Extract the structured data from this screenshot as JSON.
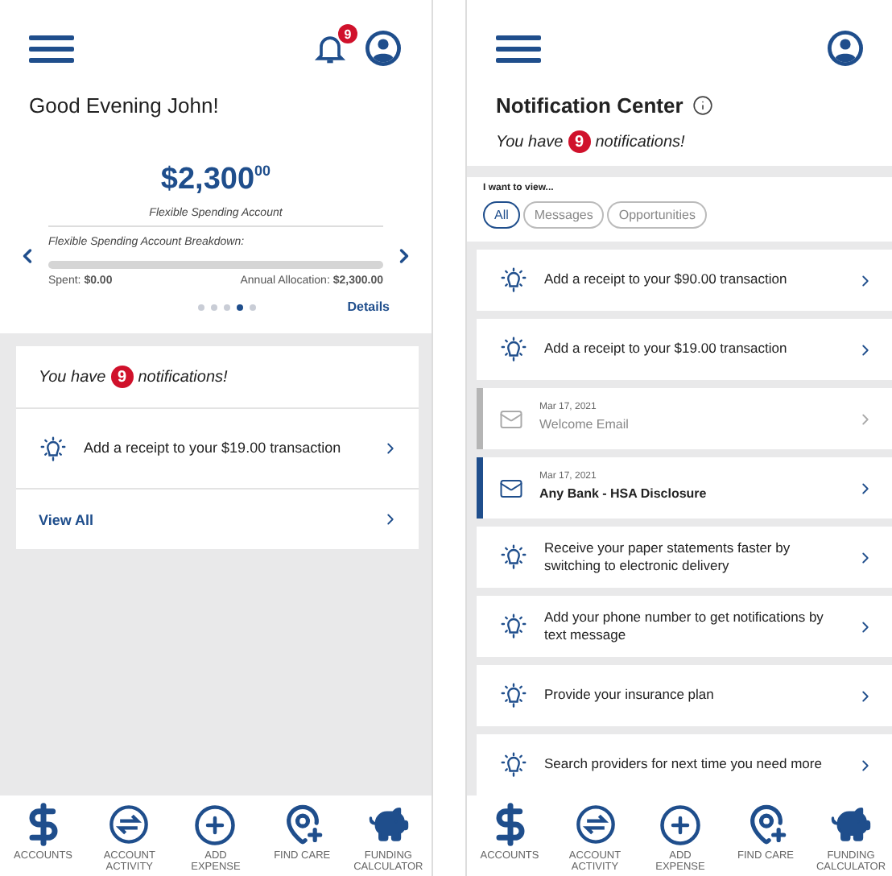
{
  "home_screen": {
    "header": {
      "notification_count": "9"
    },
    "greeting": "Good Evening John!",
    "balance": {
      "amount": "$2,300",
      "cents": "00",
      "label": "Flexible Spending Account"
    },
    "breakdown": {
      "title": "Flexible Spending Account Breakdown:",
      "level": 0,
      "spent_label": "Spent:",
      "spent": "$0.00",
      "allocation_label": "Annual Allocation:",
      "allocation": "$2,300.00"
    },
    "pager": [
      {
        "selected": false
      },
      {
        "selected": false
      },
      {
        "selected": false
      },
      {
        "selected": true
      },
      {
        "selected": false
      }
    ],
    "details_link": "Details",
    "notifications": {
      "prefix": "You have",
      "count": "9",
      "suffix": "notifications!",
      "items": [
        {
          "kind": "tip",
          "text": "Add a receipt to your $19.00 transaction"
        }
      ],
      "view_all": "View All"
    },
    "tab_bar": [
      {
        "kind": "dollar",
        "lines": [
          "ACCOUNTS"
        ]
      },
      {
        "kind": "swap",
        "lines": [
          "ACCOUNT",
          "ACTIVITY"
        ]
      },
      {
        "kind": "plus",
        "lines": [
          "ADD",
          "EXPENSE"
        ]
      },
      {
        "kind": "pin",
        "lines": [
          "FIND CARE"
        ]
      },
      {
        "kind": "piggy",
        "lines": [
          "FUNDING",
          "CALCULATOR"
        ]
      }
    ]
  },
  "notification_screen": {
    "title": "Notification Center",
    "summary": {
      "prefix": "You have",
      "count": "9",
      "suffix": "notifications!"
    },
    "filter_label": "I want to view...",
    "filters": [
      {
        "label": "All",
        "selected": true
      },
      {
        "label": "Messages",
        "selected": false
      },
      {
        "label": "Opportunities",
        "selected": false
      }
    ],
    "items": [
      {
        "kind": "tip",
        "text": "Add a receipt to your $90.00 transaction"
      },
      {
        "kind": "tip",
        "text": "Add a receipt to your $19.00 transaction"
      },
      {
        "kind": "message",
        "date": "Mar 17, 2021",
        "text": "Welcome Email",
        "read": true
      },
      {
        "kind": "message",
        "date": "Mar 17, 2021",
        "text": "Any Bank - HSA Disclosure",
        "read": false
      },
      {
        "kind": "tip",
        "text": "Receive your paper statements faster by switching to electronic delivery"
      },
      {
        "kind": "tip",
        "text": "Add your phone number to get notifications by text message"
      },
      {
        "kind": "tip",
        "text": "Provide your insurance plan"
      },
      {
        "kind": "tip",
        "text": "Search providers for next time you need more"
      }
    ],
    "tab_bar": [
      {
        "kind": "dollar",
        "lines": [
          "ACCOUNTS"
        ]
      },
      {
        "kind": "swap",
        "lines": [
          "ACCOUNT",
          "ACTIVITY"
        ]
      },
      {
        "kind": "plus",
        "lines": [
          "ADD",
          "EXPENSE"
        ]
      },
      {
        "kind": "pin",
        "lines": [
          "FIND CARE"
        ]
      },
      {
        "kind": "piggy",
        "lines": [
          "FUNDING",
          "CALCULATOR"
        ]
      }
    ]
  }
}
